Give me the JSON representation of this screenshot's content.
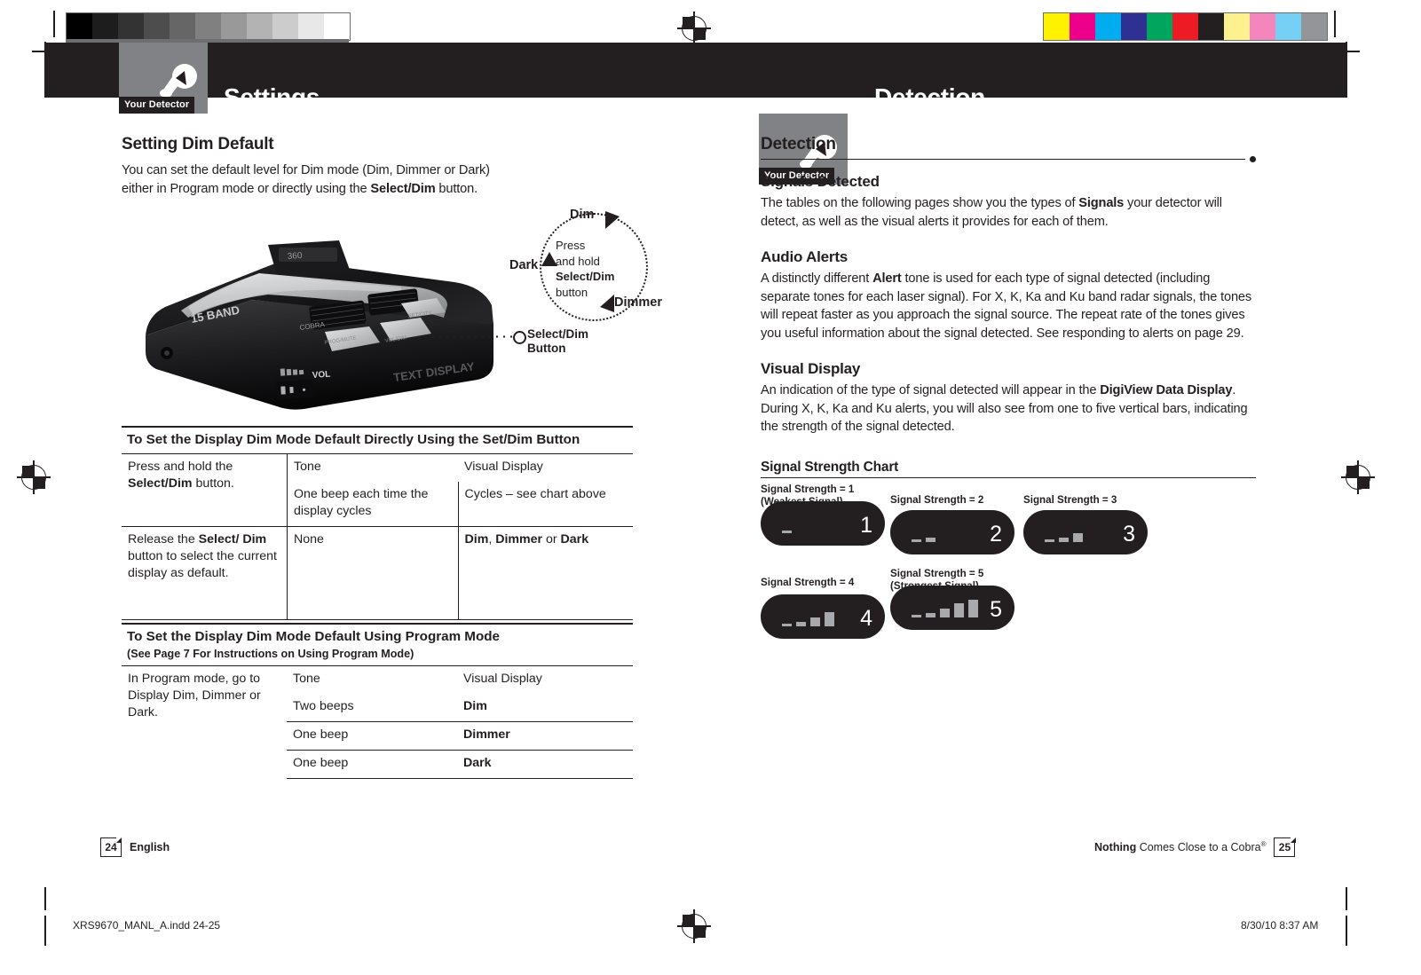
{
  "print_marks": {
    "gray_wedge": [
      "#000000",
      "#1d1d1d",
      "#333333",
      "#4d4d4d",
      "#666666",
      "#808080",
      "#999999",
      "#b3b3b3",
      "#cccccc",
      "#e8e8e8",
      "#ffffff"
    ],
    "color_bar": [
      "#fff200",
      "#ec008c",
      "#00aeef",
      "#2e3192",
      "#00a65d",
      "#ed1c24",
      "#231f20",
      "#fbf18e",
      "#f386bd",
      "#76cff4",
      "#939598"
    ],
    "slug_left": "XRS9670_MANL_A.indd   24-25",
    "slug_right": "8/30/10   8:37 AM"
  },
  "left_page": {
    "header": {
      "tab_label": "Your Detector",
      "title": "Settings"
    },
    "heading": "Setting Dim Default",
    "intro": {
      "line1": "You can set the default level for Dim mode (Dim, Dimmer or Dark)",
      "line2_a": "either in Program mode or directly using the ",
      "line2_bold": "Select/Dim",
      "line2_b": " button."
    },
    "diagram": {
      "top_label": "Dim",
      "right_label": "Dimmer",
      "left_label": "Dark",
      "center_line1": "Press",
      "center_line2": "and hold",
      "center_line3": "Select/Dim",
      "center_line4": "button",
      "callout_line1": "Select/Dim",
      "callout_line2": "Button",
      "device_badge_brand": "COBRA",
      "device_badge_band": "15 BAND",
      "device_text_display": "TEXT DISPLAY",
      "device_vol": "VOL"
    },
    "table1": {
      "title": "To Set the Display Dim Mode Default Directly Using the Set/Dim Button",
      "col_headers": [
        "Tone",
        "Visual Display"
      ],
      "rows": [
        {
          "step_a": "Press and hold the ",
          "step_bold": "Select/Dim",
          "step_b": " button.",
          "tone": "One beep each time the display cycles",
          "visual": "Cycles – see chart above"
        },
        {
          "step_a": "Release the ",
          "step_bold": "Select/ Dim",
          "step_b": " button to select the current display as default.",
          "tone": "None",
          "visual_b1": "Dim",
          "visual_sep1": ", ",
          "visual_b2": "Dimmer",
          "visual_sep2": " or ",
          "visual_b3": "Dark"
        }
      ]
    },
    "table2": {
      "title": "To Set the Display Dim Mode Default Using Program Mode",
      "subtitle": "(See Page 7 For Instructions on Using Program Mode)",
      "step": "In Program mode, go to Display Dim, Dimmer or Dark.",
      "col_headers": [
        "Tone",
        "Visual Display"
      ],
      "rows": [
        {
          "tone": "Two beeps",
          "visual": "Dim"
        },
        {
          "tone": "One beep",
          "visual": "Dimmer"
        },
        {
          "tone": "One beep",
          "visual": "Dark"
        }
      ]
    },
    "footer": {
      "page_number": "24",
      "language": "English"
    }
  },
  "right_page": {
    "header": {
      "tab_label": "Your Detector",
      "title": "Detection"
    },
    "section_title": "Detection",
    "blocks": [
      {
        "heading": "Signals Detected",
        "para_parts": [
          {
            "text": "The tables on the following pages show you the types of ",
            "bold": false
          },
          {
            "text": "Signals",
            "bold": true
          },
          {
            "text": " your detector will detect, as well as the visual alerts it provides for each of them.",
            "bold": false
          }
        ]
      },
      {
        "heading": "Audio Alerts",
        "para_parts": [
          {
            "text": "A distinctly different ",
            "bold": false
          },
          {
            "text": "Alert",
            "bold": true
          },
          {
            "text": " tone is used for each type of signal detected (including separate tones for each laser signal). For X, K, Ka and Ku band radar signals, the tones will repeat faster as you approach the signal source. The repeat rate of the tones gives you useful information about the signal detected. See responding to alerts on page 29.",
            "bold": false
          }
        ]
      },
      {
        "heading": "Visual Display",
        "para_parts": [
          {
            "text": "An indication of the type of signal detected will appear in the ",
            "bold": false
          },
          {
            "text": "DigiView Data Display",
            "bold": true
          },
          {
            "text": ". During X, K, Ka and Ku alerts, you will also see from one to five vertical bars, indicating the strength of the signal detected.",
            "bold": false
          }
        ]
      }
    ],
    "chart_heading": "Signal Strength Chart",
    "signal_chart": {
      "bar_color": "#a7a9ac",
      "display_color": "#231f20",
      "items": [
        {
          "label_line1": "Signal Strength = 1",
          "label_line2": "(Weakest Signal)",
          "number": "1",
          "bar_count": 1
        },
        {
          "label_line1": "Signal Strength = 2",
          "label_line2": "",
          "number": "2",
          "bar_count": 2
        },
        {
          "label_line1": "Signal Strength = 3",
          "label_line2": "",
          "number": "3",
          "bar_count": 3
        },
        {
          "label_line1": "Signal Strength = 4",
          "label_line2": "",
          "number": "4",
          "bar_count": 4
        },
        {
          "label_line1": "Signal Strength = 5",
          "label_line2": "(Strongest Signal)",
          "number": "5",
          "bar_count": 5
        }
      ]
    },
    "footer": {
      "tagline_bold": "Nothing",
      "tagline_rest": " Comes Close to a Cobra",
      "tagline_reg": "®",
      "page_number": "25"
    }
  }
}
